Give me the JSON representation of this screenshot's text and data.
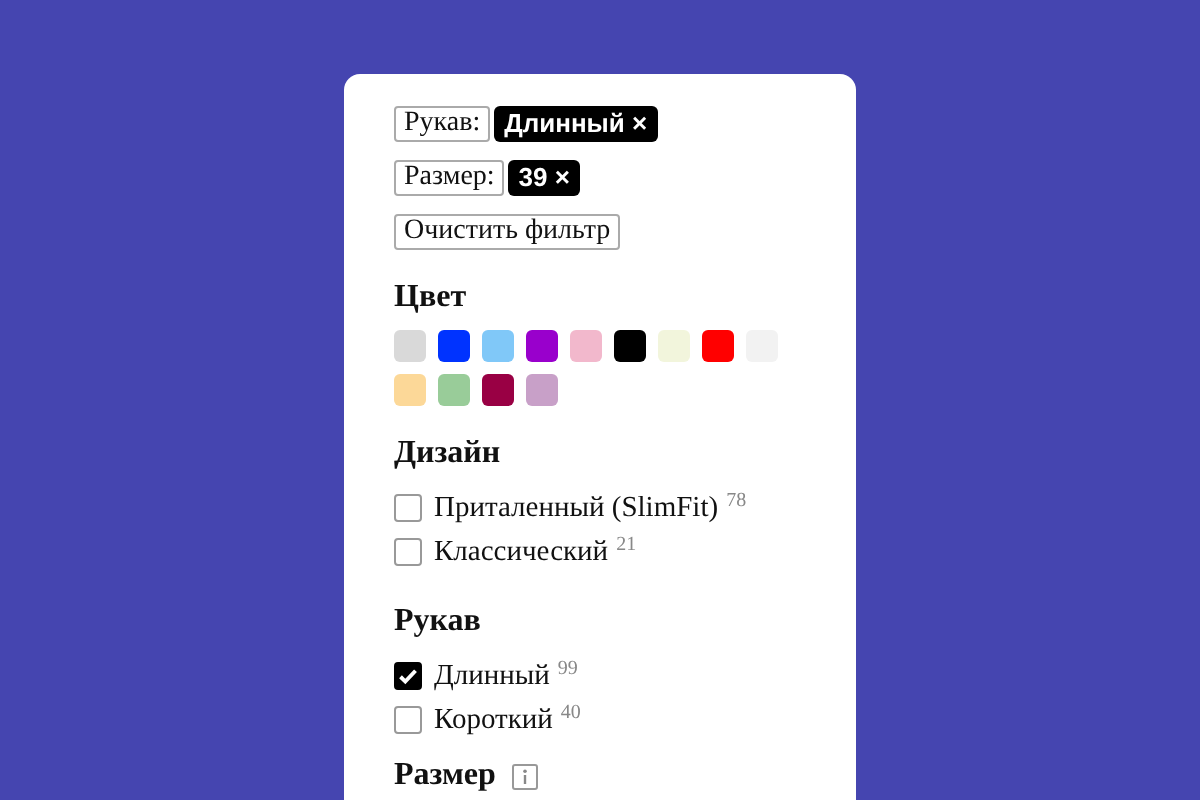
{
  "active_filters": [
    {
      "label": "Рукав:",
      "value": "Длинный",
      "remove": "×"
    },
    {
      "label": "Размер:",
      "value": "39",
      "remove": "×"
    }
  ],
  "clear_button": "Очистить фильтр",
  "color_section": {
    "title": "Цвет",
    "swatches": [
      {
        "color": "#d9d9d9"
      },
      {
        "color": "#0033ff"
      },
      {
        "color": "#80c8f8"
      },
      {
        "color": "#9900cc"
      },
      {
        "color": "#f2b8cc"
      },
      {
        "color": "#000000"
      },
      {
        "color": "#f2f5dc"
      },
      {
        "color": "#ff0000"
      },
      {
        "color": "#f2f2f2"
      },
      {
        "color": "#fcd898"
      },
      {
        "color": "#99cc99"
      },
      {
        "color": "#990044"
      },
      {
        "color": "#c8a0c8"
      }
    ]
  },
  "sections": [
    {
      "title": "Дизайн",
      "options": [
        {
          "label": "Приталенный (SlimFit)",
          "count": "78",
          "checked": false
        },
        {
          "label": "Классический",
          "count": "21",
          "checked": false
        }
      ]
    },
    {
      "title": "Рукав",
      "options": [
        {
          "label": "Длинный",
          "count": "99",
          "checked": true
        },
        {
          "label": "Короткий",
          "count": "40",
          "checked": false
        }
      ]
    }
  ],
  "size_section": {
    "title": "Размер"
  }
}
